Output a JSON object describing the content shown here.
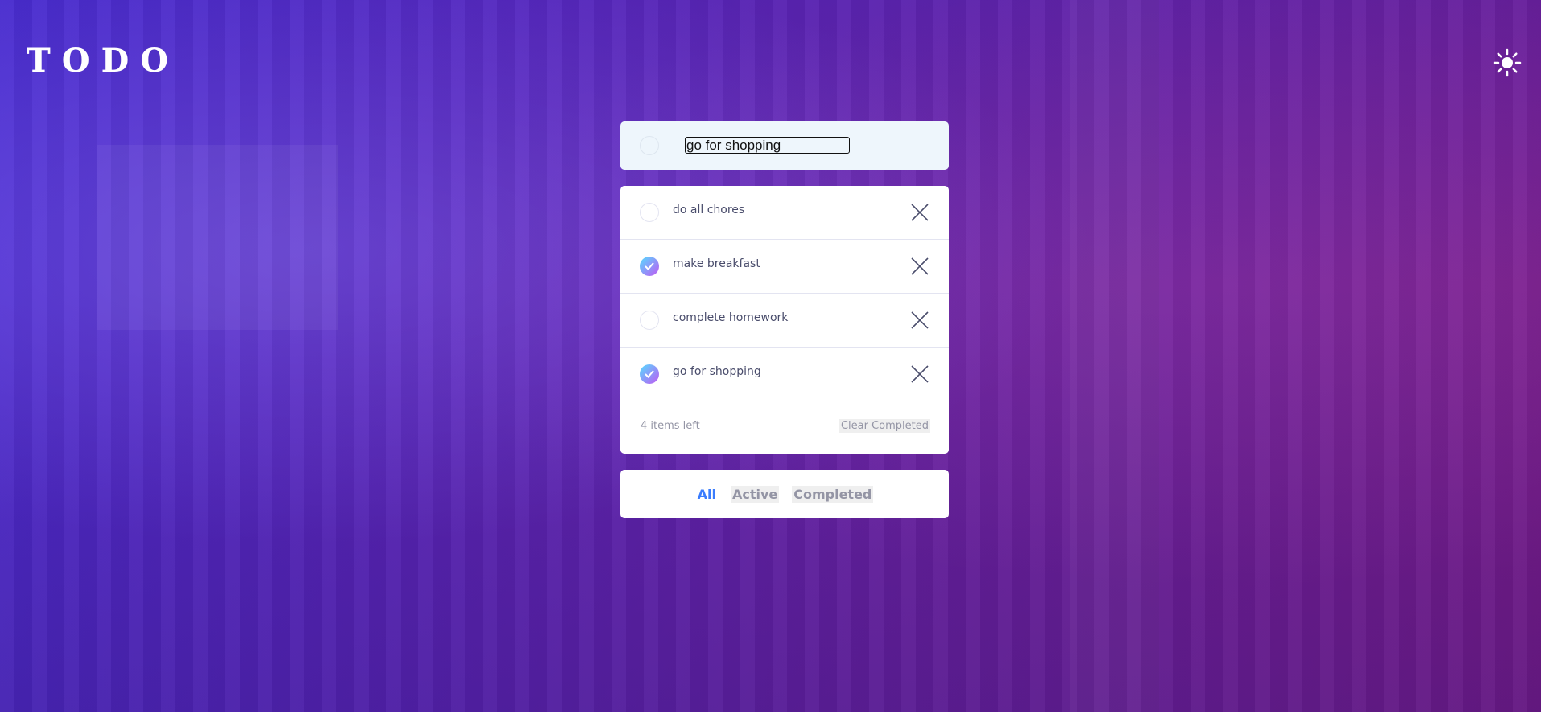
{
  "header": {
    "title": "TODO",
    "theme_toggle_icon": "sun-icon"
  },
  "new_todo": {
    "value": "go for shopping"
  },
  "todos": [
    {
      "label": "do all chores",
      "completed": false
    },
    {
      "label": "make breakfast",
      "completed": true
    },
    {
      "label": "complete homework",
      "completed": false
    },
    {
      "label": "go for shopping",
      "completed": true
    }
  ],
  "footer": {
    "items_left": "4 items left",
    "clear_completed": "Clear Completed"
  },
  "filters": {
    "all": "All",
    "active": "Active",
    "completed": "Completed",
    "selected": "All"
  },
  "colors": {
    "accent": "#3a7cfd",
    "check_gradient_start": "#55ddff",
    "check_gradient_end": "#c058f3",
    "text": "#494c6b",
    "muted": "#9495a5"
  }
}
